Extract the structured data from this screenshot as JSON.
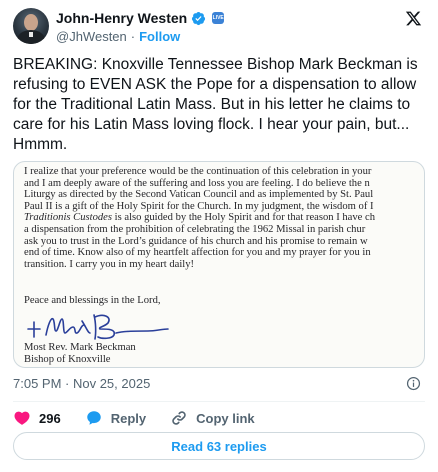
{
  "author": {
    "display_name": "John-Henry Westen",
    "handle": "@JhWesten",
    "separator": "·",
    "follow_label": "Follow",
    "verified_icon": "verified-badge-icon",
    "affiliate_badge": "LIVE"
  },
  "tweet": {
    "text": "BREAKING: Knoxville Tennessee Bishop Mark Beckman is refusing to EVEN ASK the Pope for a dispensation to allow for the Traditional Latin Mass. But in his letter he claims to care for his Latin Mass loving flock. I hear your pain, but... Hmmm.",
    "timestamp": "7:05 PM · Nov 25, 2025"
  },
  "letter": {
    "lines": [
      {
        "pre": "I realize that your preference would be the continuation of this celebration in your",
        "it": "",
        "post": ""
      },
      {
        "pre": "and I am deeply aware of the suffering and loss you are feeling.  I do believe the n",
        "it": "",
        "post": ""
      },
      {
        "pre": "Liturgy as directed by the Second Vatican Council and as implemented by St. Paul",
        "it": "",
        "post": ""
      },
      {
        "pre": "Paul II is a gift of the Holy Spirit for the Church.  In my judgment, the wisdom of I",
        "it": "",
        "post": ""
      },
      {
        "pre": "",
        "it": "Traditionis Custodes",
        "post": " is also guided by the Holy Spirit and for that reason I have ch"
      },
      {
        "pre": "a dispensation from the prohibition of celebrating the 1962 Missal in parish chur",
        "it": "",
        "post": ""
      },
      {
        "pre": "ask you to trust in the Lord’s guidance of his church and his promise to remain w",
        "it": "",
        "post": ""
      },
      {
        "pre": "end of time.  Know also of my heartfelt affection for you and my prayer for you in",
        "it": "",
        "post": ""
      },
      {
        "pre": "transition.  I carry you in my heart daily!",
        "it": "",
        "post": ""
      }
    ],
    "closing": "Peace and blessings in the Lord,",
    "signer_name": "Most Rev. Mark Beckman",
    "signer_title": "Bishop of Knoxville"
  },
  "actions": {
    "likes": "296",
    "reply_label": "Reply",
    "copy_link_label": "Copy link",
    "read_replies_label": "Read 63 replies"
  },
  "colors": {
    "link_blue": "#1d9bf0",
    "like_pink": "#f91880",
    "secondary_text": "#536471"
  }
}
